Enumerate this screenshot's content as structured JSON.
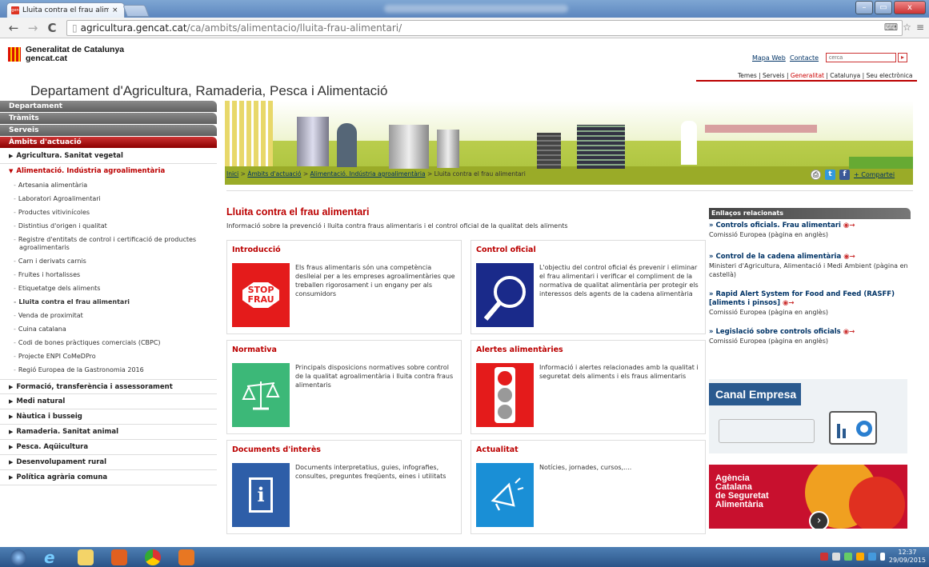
{
  "browser": {
    "tab_title": "Lluita contra el frau alimen",
    "tab_close": "×",
    "url_domain": "agricultura.gencat.cat",
    "url_path": "/ca/ambits/alimentacio/lluita-frau-alimentari/",
    "back": "←",
    "forward": "→",
    "reload": "C"
  },
  "header": {
    "org_name_1": "Generalitat de Catalunya",
    "org_name_2": "gencat.cat",
    "link_mapa": "Mapa Web",
    "link_contacte": "Contacte",
    "search_placeholder": "cerca",
    "search_button": "▸",
    "nav_temes": "Temes",
    "nav_serveis": "Serveis",
    "nav_generalitat": "Generalitat",
    "nav_catalunya": "Catalunya",
    "nav_seu": "Seu electrònica",
    "department": "Departament d'Agricultura, Ramaderia, Pesca i Alimentació"
  },
  "sidebar": {
    "bars": [
      "Departament",
      "Tràmits",
      "Serveis",
      "Àmbits d'actuació"
    ],
    "sec_agri": "Agricultura. Sanitat vegetal",
    "sec_alim": "Alimentació. Indústria agroalimentària",
    "sub_items": [
      "Artesania alimentària",
      "Laboratori Agroalimentari",
      "Productes vitivinícoles",
      "Distintius d'origen i qualitat",
      "Registre d'entitats de control i certificació de productes agroalimentaris",
      "Carn i derivats carnis",
      "Fruites i hortalisses",
      "Etiquetatge dels aliments",
      "Lluita contra el frau alimentari",
      "Venda de proximitat",
      "Cuina catalana",
      "Codi de bones pràctiques comercials (CBPC)",
      "Projecte ENPI CoMeDPro",
      "Regió Europea de la Gastronomia 2016"
    ],
    "sections": [
      "Formació, transferència i assessorament",
      "Medi natural",
      "Nàutica i busseig",
      "Ramaderia. Sanitat animal",
      "Pesca. Aqüicultura",
      "Desenvolupament rural",
      "Política agrària comuna"
    ]
  },
  "breadcrumb": {
    "b1": "Inici",
    "b2": "Àmbits d'actuació",
    "b3": "Alimentació. Indústria agroalimentària",
    "b4": "Lluita contra el frau alimentari",
    "sep": " > ",
    "share": "+ Compartei"
  },
  "main": {
    "title": "Lluita contra el frau alimentari",
    "intro": "Informació sobre la prevenció i lluita contra fraus alimentaris i el control oficial de la qualitat dels aliments",
    "cards": [
      {
        "title": "Introducció",
        "text": "Els fraus alimentaris són una competència deslleial per a les empreses agroalimentàries que treballen rigorosament i un engany per als consumidors",
        "icon_text_1": "STOP",
        "icon_text_2": "FRAU"
      },
      {
        "title": "Control oficial",
        "text": "L'objectiu del control oficial és prevenir i eliminar el frau alimentari i verificar el compliment de la normativa de qualitat alimentària per protegir els interessos dels agents de la cadena alimentària"
      },
      {
        "title": "Normativa",
        "text": "Principals disposicions normatives sobre control de la qualitat agroalimentària i lluita contra fraus alimentaris"
      },
      {
        "title": "Alertes alimentàries",
        "text": "Informació i alertes relacionades amb la qualitat i seguretat dels aliments i els fraus alimentaris"
      },
      {
        "title": "Documents d'interès",
        "text": "Documents interpretatius, guies, infografies, consultes, preguntes freqüents, eines i utilitats"
      },
      {
        "title": "Actualitat",
        "text": "Notícies, jornades, cursos,...."
      }
    ]
  },
  "related": {
    "title": "Enllaços relacionats",
    "items": [
      {
        "link": "» Controls oficials. Frau alimentari",
        "sub": "Comissió Europea (pàgina en anglès)"
      },
      {
        "link": "» Control de la cadena alimentària",
        "sub": "Ministeri d'Agricultura, Alimentació i Medi Ambient (pàgina en castellà)"
      },
      {
        "link": "» Rapid Alert System for Food and Feed (RASFF) [aliments i pinsos]",
        "sub": "Comissió Europea (pàgina en anglès)"
      },
      {
        "link": "» Legislació sobre controls oficials",
        "sub": "Comissió Europea (pàgina en anglès)"
      }
    ],
    "ad1_label": "Canal Empresa",
    "ad2_line1": "Agència",
    "ad2_line2": "Catalana",
    "ad2_line3": "de Seguretat",
    "ad2_line4": "Alimentària"
  },
  "taskbar": {
    "time": "12:37",
    "date": "29/09/2015"
  }
}
